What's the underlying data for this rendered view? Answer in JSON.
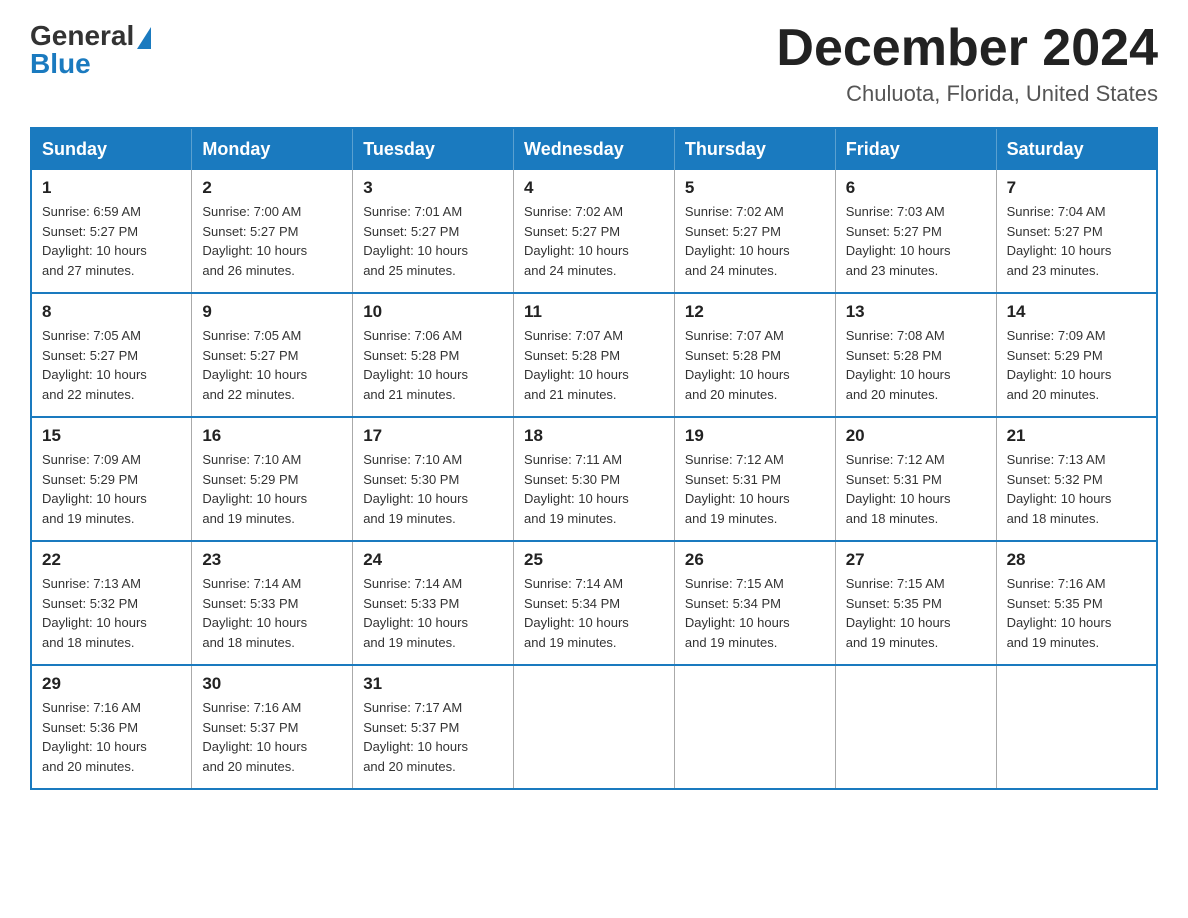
{
  "logo": {
    "general": "General",
    "blue": "Blue"
  },
  "title": "December 2024",
  "location": "Chuluota, Florida, United States",
  "days_of_week": [
    "Sunday",
    "Monday",
    "Tuesday",
    "Wednesday",
    "Thursday",
    "Friday",
    "Saturday"
  ],
  "weeks": [
    [
      {
        "day": "1",
        "sunrise": "6:59 AM",
        "sunset": "5:27 PM",
        "daylight": "10 hours and 27 minutes."
      },
      {
        "day": "2",
        "sunrise": "7:00 AM",
        "sunset": "5:27 PM",
        "daylight": "10 hours and 26 minutes."
      },
      {
        "day": "3",
        "sunrise": "7:01 AM",
        "sunset": "5:27 PM",
        "daylight": "10 hours and 25 minutes."
      },
      {
        "day": "4",
        "sunrise": "7:02 AM",
        "sunset": "5:27 PM",
        "daylight": "10 hours and 24 minutes."
      },
      {
        "day": "5",
        "sunrise": "7:02 AM",
        "sunset": "5:27 PM",
        "daylight": "10 hours and 24 minutes."
      },
      {
        "day": "6",
        "sunrise": "7:03 AM",
        "sunset": "5:27 PM",
        "daylight": "10 hours and 23 minutes."
      },
      {
        "day": "7",
        "sunrise": "7:04 AM",
        "sunset": "5:27 PM",
        "daylight": "10 hours and 23 minutes."
      }
    ],
    [
      {
        "day": "8",
        "sunrise": "7:05 AM",
        "sunset": "5:27 PM",
        "daylight": "10 hours and 22 minutes."
      },
      {
        "day": "9",
        "sunrise": "7:05 AM",
        "sunset": "5:27 PM",
        "daylight": "10 hours and 22 minutes."
      },
      {
        "day": "10",
        "sunrise": "7:06 AM",
        "sunset": "5:28 PM",
        "daylight": "10 hours and 21 minutes."
      },
      {
        "day": "11",
        "sunrise": "7:07 AM",
        "sunset": "5:28 PM",
        "daylight": "10 hours and 21 minutes."
      },
      {
        "day": "12",
        "sunrise": "7:07 AM",
        "sunset": "5:28 PM",
        "daylight": "10 hours and 20 minutes."
      },
      {
        "day": "13",
        "sunrise": "7:08 AM",
        "sunset": "5:28 PM",
        "daylight": "10 hours and 20 minutes."
      },
      {
        "day": "14",
        "sunrise": "7:09 AM",
        "sunset": "5:29 PM",
        "daylight": "10 hours and 20 minutes."
      }
    ],
    [
      {
        "day": "15",
        "sunrise": "7:09 AM",
        "sunset": "5:29 PM",
        "daylight": "10 hours and 19 minutes."
      },
      {
        "day": "16",
        "sunrise": "7:10 AM",
        "sunset": "5:29 PM",
        "daylight": "10 hours and 19 minutes."
      },
      {
        "day": "17",
        "sunrise": "7:10 AM",
        "sunset": "5:30 PM",
        "daylight": "10 hours and 19 minutes."
      },
      {
        "day": "18",
        "sunrise": "7:11 AM",
        "sunset": "5:30 PM",
        "daylight": "10 hours and 19 minutes."
      },
      {
        "day": "19",
        "sunrise": "7:12 AM",
        "sunset": "5:31 PM",
        "daylight": "10 hours and 19 minutes."
      },
      {
        "day": "20",
        "sunrise": "7:12 AM",
        "sunset": "5:31 PM",
        "daylight": "10 hours and 18 minutes."
      },
      {
        "day": "21",
        "sunrise": "7:13 AM",
        "sunset": "5:32 PM",
        "daylight": "10 hours and 18 minutes."
      }
    ],
    [
      {
        "day": "22",
        "sunrise": "7:13 AM",
        "sunset": "5:32 PM",
        "daylight": "10 hours and 18 minutes."
      },
      {
        "day": "23",
        "sunrise": "7:14 AM",
        "sunset": "5:33 PM",
        "daylight": "10 hours and 18 minutes."
      },
      {
        "day": "24",
        "sunrise": "7:14 AM",
        "sunset": "5:33 PM",
        "daylight": "10 hours and 19 minutes."
      },
      {
        "day": "25",
        "sunrise": "7:14 AM",
        "sunset": "5:34 PM",
        "daylight": "10 hours and 19 minutes."
      },
      {
        "day": "26",
        "sunrise": "7:15 AM",
        "sunset": "5:34 PM",
        "daylight": "10 hours and 19 minutes."
      },
      {
        "day": "27",
        "sunrise": "7:15 AM",
        "sunset": "5:35 PM",
        "daylight": "10 hours and 19 minutes."
      },
      {
        "day": "28",
        "sunrise": "7:16 AM",
        "sunset": "5:35 PM",
        "daylight": "10 hours and 19 minutes."
      }
    ],
    [
      {
        "day": "29",
        "sunrise": "7:16 AM",
        "sunset": "5:36 PM",
        "daylight": "10 hours and 20 minutes."
      },
      {
        "day": "30",
        "sunrise": "7:16 AM",
        "sunset": "5:37 PM",
        "daylight": "10 hours and 20 minutes."
      },
      {
        "day": "31",
        "sunrise": "7:17 AM",
        "sunset": "5:37 PM",
        "daylight": "10 hours and 20 minutes."
      },
      null,
      null,
      null,
      null
    ]
  ],
  "labels": {
    "sunrise": "Sunrise:",
    "sunset": "Sunset:",
    "daylight": "Daylight:"
  }
}
